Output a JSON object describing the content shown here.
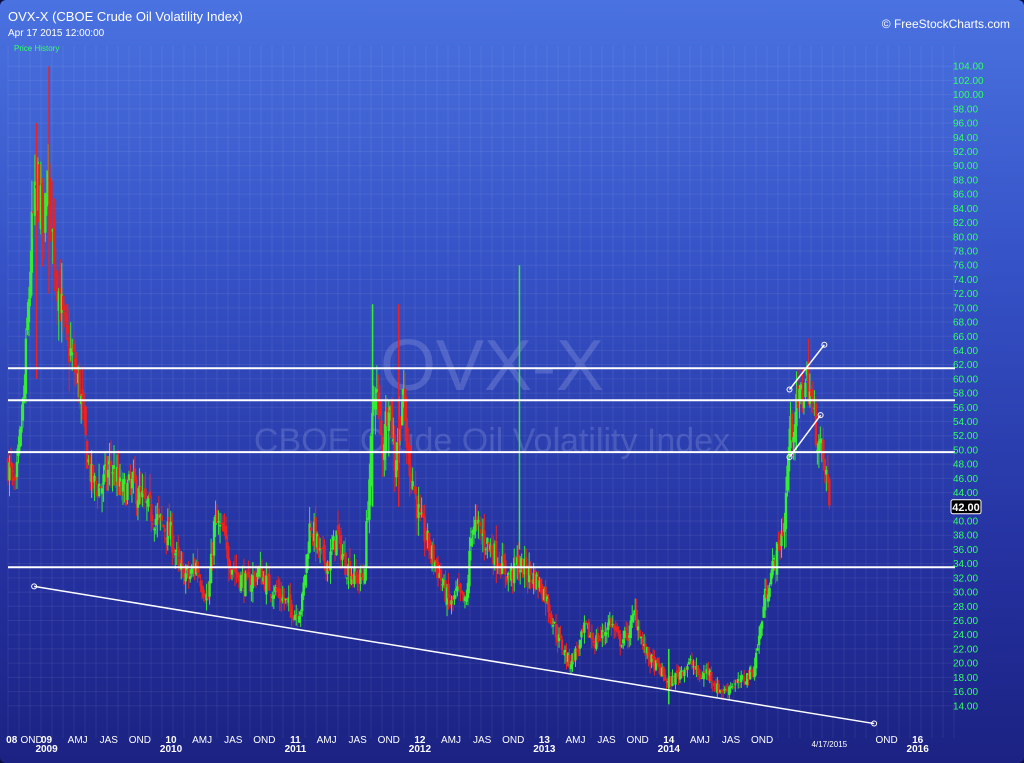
{
  "header": {
    "title": "OVX-X (CBOE Crude Oil Volatility Index)",
    "subtitle": "Apr 17 2015 12:00:00",
    "price_history_label": "Price History",
    "copyright": "© FreeStockCharts.com"
  },
  "watermark": {
    "symbol": "OVX-X",
    "name": "CBOE Crude Oil Volatility Index"
  },
  "colors": {
    "up": "#33ee33",
    "down": "#ee2020",
    "ytick": "#33ff66",
    "lines": "#ffffff"
  },
  "chart_data": {
    "type": "candlestick",
    "ylim": [
      12,
      106
    ],
    "yticks": [
      "14.00",
      "16.00",
      "18.00",
      "20.00",
      "22.00",
      "24.00",
      "26.00",
      "28.00",
      "30.00",
      "32.00",
      "34.00",
      "36.00",
      "38.00",
      "40.00",
      "42.00",
      "44.00",
      "46.00",
      "48.00",
      "50.00",
      "52.00",
      "54.00",
      "56.00",
      "58.00",
      "60.00",
      "62.00",
      "64.00",
      "66.00",
      "68.00",
      "70.00",
      "72.00",
      "74.00",
      "76.00",
      "78.00",
      "80.00",
      "82.00",
      "84.00",
      "86.00",
      "88.00",
      "90.00",
      "92.00",
      "94.00",
      "96.00",
      "98.00",
      "100.00",
      "102.00",
      "104.00"
    ],
    "xlim": [
      2008.69,
      2016.3
    ],
    "xticks": [
      {
        "label": "08",
        "t": 2008.72,
        "year": true
      },
      {
        "label": "OND",
        "t": 2008.88,
        "year": false
      },
      {
        "label": "09",
        "t": 2009.0,
        "year": true
      },
      {
        "label": "2009",
        "t": 2009.0,
        "year": true,
        "row": 2
      },
      {
        "label": "AMJ",
        "t": 2009.25,
        "year": false
      },
      {
        "label": "JAS",
        "t": 2009.5,
        "year": false
      },
      {
        "label": "OND",
        "t": 2009.75,
        "year": false
      },
      {
        "label": "10",
        "t": 2010.0,
        "year": true
      },
      {
        "label": "2010",
        "t": 2010.0,
        "year": true,
        "row": 2
      },
      {
        "label": "AMJ",
        "t": 2010.25,
        "year": false
      },
      {
        "label": "JAS",
        "t": 2010.5,
        "year": false
      },
      {
        "label": "OND",
        "t": 2010.75,
        "year": false
      },
      {
        "label": "11",
        "t": 2011.0,
        "year": true
      },
      {
        "label": "2011",
        "t": 2011.0,
        "year": true,
        "row": 2
      },
      {
        "label": "AMJ",
        "t": 2011.25,
        "year": false
      },
      {
        "label": "JAS",
        "t": 2011.5,
        "year": false
      },
      {
        "label": "OND",
        "t": 2011.75,
        "year": false
      },
      {
        "label": "12",
        "t": 2012.0,
        "year": true
      },
      {
        "label": "2012",
        "t": 2012.0,
        "year": true,
        "row": 2
      },
      {
        "label": "AMJ",
        "t": 2012.25,
        "year": false
      },
      {
        "label": "JAS",
        "t": 2012.5,
        "year": false
      },
      {
        "label": "OND",
        "t": 2012.75,
        "year": false
      },
      {
        "label": "13",
        "t": 2013.0,
        "year": true
      },
      {
        "label": "2013",
        "t": 2013.0,
        "year": true,
        "row": 2
      },
      {
        "label": "AMJ",
        "t": 2013.25,
        "year": false
      },
      {
        "label": "JAS",
        "t": 2013.5,
        "year": false
      },
      {
        "label": "OND",
        "t": 2013.75,
        "year": false
      },
      {
        "label": "14",
        "t": 2014.0,
        "year": true
      },
      {
        "label": "2014",
        "t": 2014.0,
        "year": true,
        "row": 2
      },
      {
        "label": "AMJ",
        "t": 2014.25,
        "year": false
      },
      {
        "label": "JAS",
        "t": 2014.5,
        "year": false
      },
      {
        "label": "OND",
        "t": 2014.75,
        "year": false
      },
      {
        "label": "OND",
        "t": 2015.75,
        "year": false
      },
      {
        "label": "16",
        "t": 2016.0,
        "year": true
      },
      {
        "label": "2016",
        "t": 2016.0,
        "year": true,
        "row": 2
      }
    ],
    "date_marker": {
      "label": "4/17/2015",
      "t": 2015.29
    },
    "last_value": {
      "label": "42.00",
      "value": 42.0
    },
    "horizontal_lines": [
      61.5,
      57.0,
      49.7,
      33.5
    ],
    "trendlines": [
      {
        "t1": 2008.9,
        "v1": 30.8,
        "t2": 2015.65,
        "v2": 11.5
      },
      {
        "t1": 2014.97,
        "v1": 58.5,
        "t2": 2015.25,
        "v2": 64.8
      },
      {
        "t1": 2014.97,
        "v1": 49.0,
        "t2": 2015.22,
        "v2": 54.9
      }
    ],
    "price_path": [
      {
        "t": 2008.69,
        "v": 48
      },
      {
        "t": 2008.75,
        "v": 44
      },
      {
        "t": 2008.82,
        "v": 58
      },
      {
        "t": 2008.88,
        "v": 80
      },
      {
        "t": 2008.93,
        "v": 88
      },
      {
        "t": 2008.98,
        "v": 78
      },
      {
        "t": 2009.0,
        "v": 90
      },
      {
        "t": 2009.05,
        "v": 80
      },
      {
        "t": 2009.1,
        "v": 72
      },
      {
        "t": 2009.15,
        "v": 66
      },
      {
        "t": 2009.22,
        "v": 62
      },
      {
        "t": 2009.27,
        "v": 58
      },
      {
        "t": 2009.32,
        "v": 50
      },
      {
        "t": 2009.37,
        "v": 45
      },
      {
        "t": 2009.45,
        "v": 45
      },
      {
        "t": 2009.52,
        "v": 48
      },
      {
        "t": 2009.6,
        "v": 44
      },
      {
        "t": 2009.7,
        "v": 45
      },
      {
        "t": 2009.8,
        "v": 42
      },
      {
        "t": 2009.9,
        "v": 40
      },
      {
        "t": 2010.0,
        "v": 38
      },
      {
        "t": 2010.07,
        "v": 33
      },
      {
        "t": 2010.15,
        "v": 32
      },
      {
        "t": 2010.2,
        "v": 34
      },
      {
        "t": 2010.27,
        "v": 30
      },
      {
        "t": 2010.3,
        "v": 29
      },
      {
        "t": 2010.35,
        "v": 40
      },
      {
        "t": 2010.42,
        "v": 38
      },
      {
        "t": 2010.48,
        "v": 34
      },
      {
        "t": 2010.55,
        "v": 32
      },
      {
        "t": 2010.62,
        "v": 31
      },
      {
        "t": 2010.7,
        "v": 33
      },
      {
        "t": 2010.78,
        "v": 31
      },
      {
        "t": 2010.85,
        "v": 30
      },
      {
        "t": 2010.95,
        "v": 28
      },
      {
        "t": 2011.0,
        "v": 27
      },
      {
        "t": 2011.05,
        "v": 28
      },
      {
        "t": 2011.12,
        "v": 40
      },
      {
        "t": 2011.2,
        "v": 35
      },
      {
        "t": 2011.27,
        "v": 34
      },
      {
        "t": 2011.33,
        "v": 38
      },
      {
        "t": 2011.4,
        "v": 34
      },
      {
        "t": 2011.48,
        "v": 32
      },
      {
        "t": 2011.55,
        "v": 32
      },
      {
        "t": 2011.6,
        "v": 48
      },
      {
        "t": 2011.64,
        "v": 60
      },
      {
        "t": 2011.7,
        "v": 50
      },
      {
        "t": 2011.75,
        "v": 58
      },
      {
        "t": 2011.8,
        "v": 48
      },
      {
        "t": 2011.86,
        "v": 58
      },
      {
        "t": 2011.9,
        "v": 50
      },
      {
        "t": 2011.96,
        "v": 44
      },
      {
        "t": 2012.0,
        "v": 40
      },
      {
        "t": 2012.08,
        "v": 36
      },
      {
        "t": 2012.15,
        "v": 33
      },
      {
        "t": 2012.2,
        "v": 30
      },
      {
        "t": 2012.25,
        "v": 28
      },
      {
        "t": 2012.3,
        "v": 30
      },
      {
        "t": 2012.37,
        "v": 28
      },
      {
        "t": 2012.42,
        "v": 40
      },
      {
        "t": 2012.5,
        "v": 38
      },
      {
        "t": 2012.58,
        "v": 36
      },
      {
        "t": 2012.65,
        "v": 34
      },
      {
        "t": 2012.72,
        "v": 32
      },
      {
        "t": 2012.78,
        "v": 34
      },
      {
        "t": 2012.85,
        "v": 33
      },
      {
        "t": 2012.92,
        "v": 32
      },
      {
        "t": 2013.0,
        "v": 30
      },
      {
        "t": 2013.05,
        "v": 27
      },
      {
        "t": 2013.1,
        "v": 24
      },
      {
        "t": 2013.15,
        "v": 22
      },
      {
        "t": 2013.2,
        "v": 20
      },
      {
        "t": 2013.27,
        "v": 22
      },
      {
        "t": 2013.33,
        "v": 25
      },
      {
        "t": 2013.4,
        "v": 23
      },
      {
        "t": 2013.47,
        "v": 24
      },
      {
        "t": 2013.53,
        "v": 26
      },
      {
        "t": 2013.6,
        "v": 23
      },
      {
        "t": 2013.67,
        "v": 24
      },
      {
        "t": 2013.73,
        "v": 27
      },
      {
        "t": 2013.8,
        "v": 22
      },
      {
        "t": 2013.87,
        "v": 20
      },
      {
        "t": 2013.93,
        "v": 19
      },
      {
        "t": 2014.0,
        "v": 17
      },
      {
        "t": 2014.05,
        "v": 18
      },
      {
        "t": 2014.1,
        "v": 19
      },
      {
        "t": 2014.18,
        "v": 20
      },
      {
        "t": 2014.25,
        "v": 18
      },
      {
        "t": 2014.32,
        "v": 19
      },
      {
        "t": 2014.38,
        "v": 16.5
      },
      {
        "t": 2014.45,
        "v": 16
      },
      {
        "t": 2014.5,
        "v": 17
      },
      {
        "t": 2014.55,
        "v": 17
      },
      {
        "t": 2014.62,
        "v": 18
      },
      {
        "t": 2014.68,
        "v": 19
      },
      {
        "t": 2014.73,
        "v": 24
      },
      {
        "t": 2014.78,
        "v": 30
      },
      {
        "t": 2014.83,
        "v": 33
      },
      {
        "t": 2014.88,
        "v": 36
      },
      {
        "t": 2014.93,
        "v": 40
      },
      {
        "t": 2014.97,
        "v": 52
      },
      {
        "t": 2015.02,
        "v": 55
      },
      {
        "t": 2015.07,
        "v": 58
      },
      {
        "t": 2015.12,
        "v": 60
      },
      {
        "t": 2015.17,
        "v": 54
      },
      {
        "t": 2015.22,
        "v": 50
      },
      {
        "t": 2015.27,
        "v": 46
      },
      {
        "t": 2015.29,
        "v": 42
      }
    ],
    "spikes": [
      {
        "t": 2009.02,
        "high": 104,
        "low": 72
      },
      {
        "t": 2012.8,
        "high": 76,
        "low": 36
      },
      {
        "t": 2011.83,
        "high": 70.5,
        "low": 42
      },
      {
        "t": 2011.62,
        "high": 70.5,
        "low": 42
      },
      {
        "t": 2008.92,
        "high": 96,
        "low": 60
      },
      {
        "t": 2014.0,
        "high": 22,
        "low": 14.2
      }
    ]
  }
}
